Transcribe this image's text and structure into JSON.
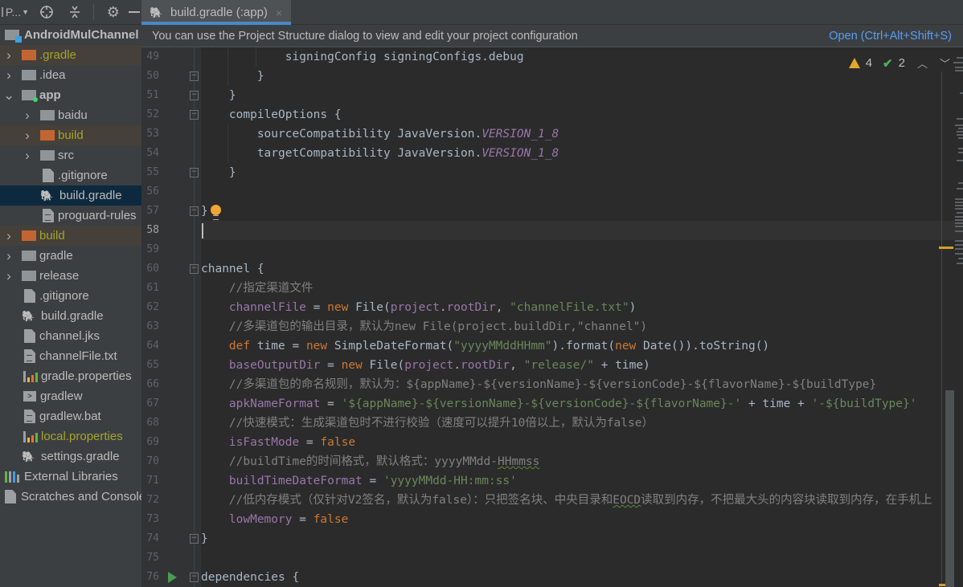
{
  "toolbar": {
    "project_selector": "P...",
    "icons": [
      "locate-icon",
      "collapse-all-icon",
      "settings-gear-icon",
      "hide-icon"
    ]
  },
  "tree": [
    {
      "label": "AndroidMulChannel",
      "depth": 0,
      "type": "module-root",
      "bold": true
    },
    {
      "label": ".gradle",
      "depth": 0,
      "type": "folder-orange",
      "chevron": "right",
      "excluded": true
    },
    {
      "label": ".idea",
      "depth": 0,
      "type": "folder",
      "chevron": "right"
    },
    {
      "label": "app",
      "depth": 0,
      "type": "folder-module",
      "chevron": "down",
      "bold": true
    },
    {
      "label": "baidu",
      "depth": 1,
      "type": "folder",
      "chevron": "right"
    },
    {
      "label": "build",
      "depth": 1,
      "type": "folder-orange",
      "chevron": "right",
      "excluded": true
    },
    {
      "label": "src",
      "depth": 1,
      "type": "folder",
      "chevron": "right"
    },
    {
      "label": ".gitignore",
      "depth": 1,
      "type": "file-ignore"
    },
    {
      "label": "build.gradle",
      "depth": 1,
      "type": "gradle",
      "selected": true
    },
    {
      "label": "proguard-rules",
      "depth": 1,
      "type": "file-text"
    },
    {
      "label": "build",
      "depth": 0,
      "type": "folder-orange",
      "chevron": "right",
      "excluded": true
    },
    {
      "label": "gradle",
      "depth": 0,
      "type": "folder",
      "chevron": "right"
    },
    {
      "label": "release",
      "depth": 0,
      "type": "folder",
      "chevron": "right"
    },
    {
      "label": ".gitignore",
      "depth": 0,
      "type": "file-ignore"
    },
    {
      "label": "build.gradle",
      "depth": 0,
      "type": "gradle"
    },
    {
      "label": "channel.jks",
      "depth": 0,
      "type": "file-unknown"
    },
    {
      "label": "channelFile.txt",
      "depth": 0,
      "type": "file-text"
    },
    {
      "label": "gradle.properties",
      "depth": 0,
      "type": "properties"
    },
    {
      "label": "gradlew",
      "depth": 0,
      "type": "terminal"
    },
    {
      "label": "gradlew.bat",
      "depth": 0,
      "type": "file-text"
    },
    {
      "label": "local.properties",
      "depth": 0,
      "type": "properties",
      "yellow": true
    },
    {
      "label": "settings.gradle",
      "depth": 0,
      "type": "gradle"
    },
    {
      "label": "External Libraries",
      "depth": -1,
      "type": "libraries"
    },
    {
      "label": "Scratches and Consoles",
      "depth": -1,
      "type": "scratches"
    }
  ],
  "tab": {
    "label": "build.gradle (:app)",
    "close": "×"
  },
  "banner": {
    "message": "You can use the Project Structure dialog to view and edit your project configuration",
    "link": "Open (Ctrl+Alt+Shift+S)"
  },
  "inspection": {
    "warnings": "4",
    "weak_warnings": "2",
    "up": "^",
    "down": "⌄"
  },
  "editor": {
    "current_line": 58,
    "lines": [
      {
        "n": 49,
        "indent": 3,
        "seg": [
          [
            "signingConfig signingConfigs.debug",
            ""
          ]
        ]
      },
      {
        "n": 50,
        "indent": 2,
        "fold": "end",
        "seg": [
          [
            "}",
            ""
          ]
        ]
      },
      {
        "n": 51,
        "indent": 1,
        "fold": "end",
        "seg": [
          [
            "}",
            ""
          ]
        ]
      },
      {
        "n": 52,
        "indent": 1,
        "fold": "start",
        "seg": [
          [
            "compileOptions {",
            ""
          ]
        ]
      },
      {
        "n": 53,
        "indent": 2,
        "seg": [
          [
            "sourceCompatibility JavaVersion.",
            ""
          ],
          [
            "VERSION_1_8",
            "const"
          ]
        ]
      },
      {
        "n": 54,
        "indent": 2,
        "seg": [
          [
            "targetCompatibility JavaVersion.",
            ""
          ],
          [
            "VERSION_1_8",
            "const"
          ]
        ]
      },
      {
        "n": 55,
        "indent": 1,
        "fold": "end",
        "seg": [
          [
            "}",
            ""
          ]
        ]
      },
      {
        "n": 56,
        "indent": 0,
        "seg": []
      },
      {
        "n": 57,
        "indent": 0,
        "fold": "end",
        "bulb": true,
        "seg": [
          [
            "}",
            ""
          ]
        ]
      },
      {
        "n": 58,
        "indent": 0,
        "caret": true,
        "seg": []
      },
      {
        "n": 59,
        "indent": 0,
        "seg": []
      },
      {
        "n": 60,
        "indent": 0,
        "fold": "start",
        "seg": [
          [
            "channel {",
            ""
          ]
        ]
      },
      {
        "n": 61,
        "indent": 1,
        "seg": [
          [
            "//指定渠道文件",
            "cmt"
          ]
        ]
      },
      {
        "n": 62,
        "indent": 1,
        "seg": [
          [
            "channelFile",
            "prop"
          ],
          [
            " = ",
            ""
          ],
          [
            "new",
            "kw"
          ],
          [
            " File(",
            ""
          ],
          [
            "project",
            "prop"
          ],
          [
            ".",
            ""
          ],
          [
            "rootDir",
            "prop"
          ],
          [
            ", ",
            ""
          ],
          [
            "\"channelFile.txt\"",
            "str"
          ],
          [
            ")",
            ""
          ]
        ]
      },
      {
        "n": 63,
        "indent": 1,
        "seg": [
          [
            "//多渠道包的输出目录，默认为new File(project.buildDir,\"channel\")",
            "cmt"
          ]
        ]
      },
      {
        "n": 64,
        "indent": 1,
        "seg": [
          [
            "def",
            "kw"
          ],
          [
            " time = ",
            ""
          ],
          [
            "new",
            "kw"
          ],
          [
            " SimpleDateFormat(",
            ""
          ],
          [
            "\"yyyyMMddHHmm\"",
            "str"
          ],
          [
            ").format(",
            ""
          ],
          [
            "new",
            "kw"
          ],
          [
            " Date()).toString()",
            ""
          ]
        ]
      },
      {
        "n": 65,
        "indent": 1,
        "seg": [
          [
            "baseOutputDir",
            "prop"
          ],
          [
            " = ",
            ""
          ],
          [
            "new",
            "kw"
          ],
          [
            " File(",
            ""
          ],
          [
            "project",
            "prop"
          ],
          [
            ".",
            ""
          ],
          [
            "rootDir",
            "prop"
          ],
          [
            ", ",
            ""
          ],
          [
            "\"release/\"",
            "str"
          ],
          [
            " + time)",
            ""
          ]
        ]
      },
      {
        "n": 66,
        "indent": 1,
        "seg": [
          [
            "//多渠道包的命名规则，默认为：${appName}-${versionName}-${versionCode}-${flavorName}-${buildType}",
            "cmt"
          ]
        ]
      },
      {
        "n": 67,
        "indent": 1,
        "seg": [
          [
            "apkNameFormat",
            "prop"
          ],
          [
            " = ",
            ""
          ],
          [
            "'${appName}-${versionName}-${versionCode}-${flavorName}-'",
            "str"
          ],
          [
            " + time + ",
            ""
          ],
          [
            "'-${buildType}'",
            "str"
          ]
        ]
      },
      {
        "n": 68,
        "indent": 1,
        "seg": [
          [
            "//快速模式：生成渠道包时不进行校验（速度可以提升10倍以上，默认为false）",
            "cmt"
          ]
        ]
      },
      {
        "n": 69,
        "indent": 1,
        "seg": [
          [
            "isFastMode",
            "prop"
          ],
          [
            " = ",
            ""
          ],
          [
            "false",
            "kw"
          ]
        ]
      },
      {
        "n": 70,
        "indent": 1,
        "seg": [
          [
            "//buildTime的时间格式，默认格式：yyyyMMdd-",
            "cmt"
          ],
          [
            "HHmmss",
            "cmt typo"
          ]
        ]
      },
      {
        "n": 71,
        "indent": 1,
        "seg": [
          [
            "buildTimeDateFormat",
            "prop"
          ],
          [
            " = ",
            ""
          ],
          [
            "'yyyyMMdd-HH:mm:ss'",
            "str"
          ]
        ]
      },
      {
        "n": 72,
        "indent": 1,
        "seg": [
          [
            "//低内存模式（仅针对V2签名，默认为false）：只把签名块、中央目录和",
            "cmt"
          ],
          [
            "EOCD",
            "cmt typo"
          ],
          [
            "读取到内存，不把最大头的内容块读取到内存，在手机上",
            "cmt"
          ]
        ]
      },
      {
        "n": 73,
        "indent": 1,
        "seg": [
          [
            "lowMemory",
            "prop"
          ],
          [
            " = ",
            ""
          ],
          [
            "false",
            "kw"
          ]
        ]
      },
      {
        "n": 74,
        "indent": 0,
        "fold": "end",
        "seg": [
          [
            "}",
            ""
          ]
        ]
      },
      {
        "n": 75,
        "indent": 0,
        "seg": []
      },
      {
        "n": 76,
        "indent": 0,
        "fold": "start",
        "run": true,
        "seg": [
          [
            "dependencies {",
            ""
          ]
        ]
      }
    ]
  },
  "colors": {
    "accent": "#4a88c7",
    "link": "#589df6",
    "keyword": "#cc7832",
    "property": "#9876aa",
    "string": "#6a8759",
    "comment": "#808080",
    "warning": "#e0a92b",
    "ok": "#4eae5b"
  }
}
